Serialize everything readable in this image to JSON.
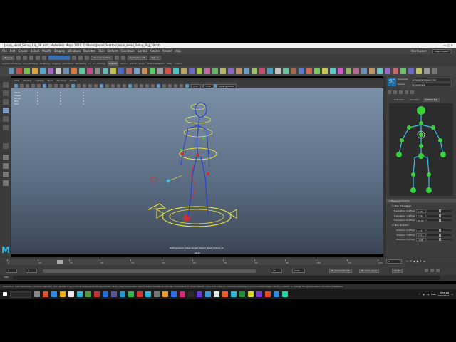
{
  "window": {
    "title": "Jason_Head_Setup_Rig_39.mb* - Autodesk Maya 2020: C:\\Users\\Jason\\Desktop\\Jason_Head_Setup_Rig_39.mb",
    "tab_title": "Jason_L_Leg_Kneelk_Ctrl"
  },
  "menubar": {
    "items": [
      "File",
      "Edit",
      "Create",
      "Select",
      "Modify",
      "Display",
      "Windows",
      "Skeleton",
      "Skin",
      "Deform",
      "Constrain",
      "Control",
      "Cache",
      "Arnold",
      "Help"
    ],
    "workspace_label": "Workspace:",
    "workspace_value": "Maya Classic*"
  },
  "statusline": {
    "mode": "Rigging",
    "no_live_surface": "No Live Surface",
    "symmetry": "Symmetry: Off",
    "sign_in": "Sign In"
  },
  "shelf_tabs": {
    "items": [
      "Curves / Surfaces",
      "Poly Modeling",
      "Sculpting",
      "Rigging",
      "Animation",
      "Rendering",
      "FX",
      "FX Caching",
      "Custom",
      "Arnold",
      "Bifrost",
      "MASH",
      "Motion Graphics",
      "XGen",
      "TURTLE"
    ],
    "active_index": 8
  },
  "panel": {
    "menu": [
      "View",
      "Shading",
      "Lighting",
      "Show",
      "Renderer",
      "Panels"
    ],
    "camera_field": "sRGB gamma",
    "exposure": "0.00",
    "gamma": "1.00"
  },
  "hud": {
    "rows": [
      {
        "label": "Verts:",
        "a": "0",
        "b": "0",
        "c": "0"
      },
      {
        "label": "Edges:",
        "a": "0",
        "b": "0",
        "c": "0"
      },
      {
        "label": "Faces:",
        "a": "0",
        "b": "0",
        "c": "0"
      },
      {
        "label": "Tris:",
        "a": "0",
        "b": "0",
        "c": "0"
      },
      {
        "label": "UVs:",
        "a": "0",
        "b": "0",
        "c": "0"
      }
    ]
  },
  "viewport": {
    "caption": "Editing blend shape target: Upper_Eyelid_Down_R...",
    "camera": "persp"
  },
  "human_ik": {
    "character_label": "Character",
    "character_value": "Character1(Jason rig)",
    "source_label": "Source",
    "source_value": "Character1",
    "tabs": [
      "Definition",
      "Skeleton",
      "Custom Rig"
    ],
    "active_tab": 2,
    "mapping_section": "Mapping Controls",
    "map_translation": "Map Translation",
    "translation_fields": [
      {
        "label": "Translation X Offset",
        "value": "0.00"
      },
      {
        "label": "Translation Y Offset",
        "value": "7.16"
      },
      {
        "label": "Translation Z Offset",
        "value": "65.96"
      }
    ],
    "map_rotation": "Map Rotation",
    "rotation_fields": [
      {
        "label": "Rotation X Offset",
        "value": "1.25"
      },
      {
        "label": "Rotation Y Offset",
        "value": "0.17"
      },
      {
        "label": "Rotation Z Offset",
        "value": "-1.09"
      }
    ]
  },
  "timeline": {
    "ticks": [
      "1",
      "10",
      "20",
      "30",
      "40",
      "50",
      "60",
      "70",
      "80",
      "90",
      "100",
      "110",
      "120"
    ],
    "current_frame": "1",
    "range_start": "1",
    "range_end": "30",
    "anim_end": "3000",
    "no_character_set": "No Character Set",
    "no_anim_layer": "No Anim Layer",
    "fps": "24 fps"
  },
  "cmdline": {
    "label": "MEL"
  },
  "helpline": {
    "text": "Move Tool: Use manipulator to move object(s). Ctrl+Middle drag to move components along normals. Shift+drag manipulator axis or plane handles to extrude components or clone objects. Ctrl+Shift+drag to constrain movement to a connected edge. Use D or INSERT to change the pivot position and axis orientation."
  },
  "taskbar": {
    "time": "9:55 PM",
    "date": "7/06/2020",
    "lang": "ENG"
  },
  "colors": {
    "maya_blue": "#2ab7d8",
    "hik_green": "#38d23c",
    "rig_yellow": "#e8e23a",
    "rig_blue": "#2a3ed8",
    "rig_red": "#e02a2a"
  }
}
